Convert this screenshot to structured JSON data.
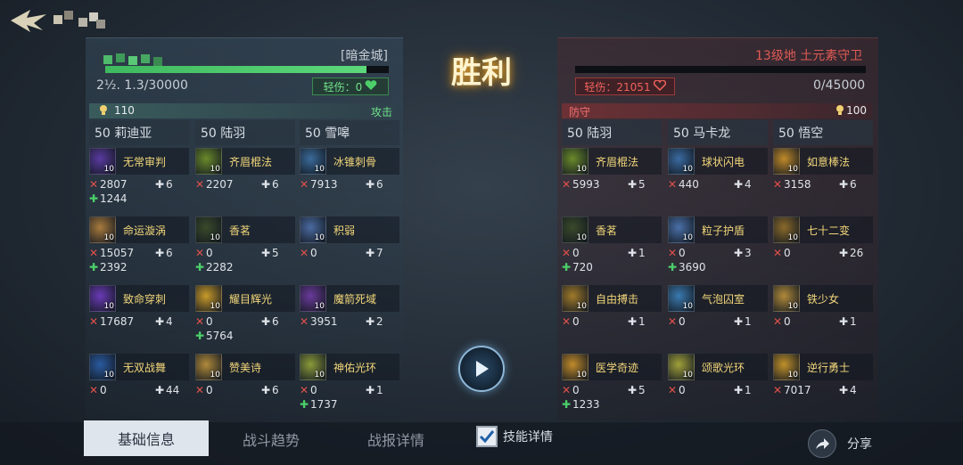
{
  "title": "胜利",
  "left": {
    "player_name": "",
    "city": "[暗金城]",
    "troops": "2½. 1.3/30000",
    "injury_label": "轻伤：0",
    "troop_fill": 0.92,
    "side_count": "110",
    "side_label": "攻击",
    "heroes": [
      {
        "header": "50 莉迪亚",
        "skills": [
          {
            "name": "无常审判",
            "level": "10",
            "kills": "2807",
            "plus": "6",
            "heal": "1244",
            "color": "#5a3aa0"
          },
          {
            "name": "命运漩涡",
            "level": "10",
            "kills": "15057",
            "plus": "6",
            "heal": "2392",
            "color": "#a87a3c"
          },
          {
            "name": "致命穿刺",
            "level": "10",
            "kills": "17687",
            "plus": "4",
            "heal": "",
            "color": "#6a3ab6"
          },
          {
            "name": "无双战舞",
            "level": "10",
            "kills": "0",
            "plus": "44",
            "heal": "",
            "color": "#2a5aa0"
          }
        ]
      },
      {
        "header": "50 陆羽",
        "skills": [
          {
            "name": "齐眉棍法",
            "level": "10",
            "kills": "2207",
            "plus": "6",
            "heal": "",
            "color": "#6a8a2a"
          },
          {
            "name": "香茗",
            "level": "10",
            "kills": "0",
            "plus": "5",
            "heal": "2282",
            "color": "#3a4a2a"
          },
          {
            "name": "耀目辉光",
            "level": "10",
            "kills": "0",
            "plus": "6",
            "heal": "5764",
            "color": "#c89a2a"
          },
          {
            "name": "赞美诗",
            "level": "10",
            "kills": "0",
            "plus": "6",
            "heal": "",
            "color": "#b08a3a"
          }
        ]
      },
      {
        "header": "50 雪嗥",
        "skills": [
          {
            "name": "冰锥刺骨",
            "level": "10",
            "kills": "7913",
            "plus": "6",
            "heal": "",
            "color": "#3a6a9a"
          },
          {
            "name": "积弱",
            "level": "10",
            "kills": "0",
            "plus": "7",
            "heal": "",
            "color": "#4a6aa0"
          },
          {
            "name": "魔箭死域",
            "level": "10",
            "kills": "3951",
            "plus": "2",
            "heal": "",
            "color": "#6a3a9a"
          },
          {
            "name": "神佑光环",
            "level": "10",
            "kills": "0",
            "plus": "1",
            "heal": "1737",
            "color": "#8a9a3a"
          }
        ]
      }
    ]
  },
  "right": {
    "enemy_title": "13级地 土元素守卫",
    "troops": "0/45000",
    "injury_label": "轻伤：21051",
    "troop_fill": 0.0,
    "side_count": "100",
    "side_label": "防守",
    "heroes": [
      {
        "header": "50 陆羽",
        "skills": [
          {
            "name": "齐眉棍法",
            "level": "10",
            "kills": "5993",
            "plus": "5",
            "heal": "",
            "color": "#6a8a2a"
          },
          {
            "name": "香茗",
            "level": "10",
            "kills": "0",
            "plus": "1",
            "heal": "720",
            "color": "#3a4a2a"
          },
          {
            "name": "自由搏击",
            "level": "10",
            "kills": "0",
            "plus": "1",
            "heal": "",
            "color": "#a07a2a"
          },
          {
            "name": "医学奇迹",
            "level": "10",
            "kills": "0",
            "plus": "5",
            "heal": "1233",
            "color": "#c08a2a"
          }
        ]
      },
      {
        "header": "50 马卡龙",
        "skills": [
          {
            "name": "球状闪电",
            "level": "10",
            "kills": "440",
            "plus": "4",
            "heal": "",
            "color": "#3a6aa0"
          },
          {
            "name": "粒子护盾",
            "level": "10",
            "kills": "0",
            "plus": "3",
            "heal": "3690",
            "color": "#4a70a8"
          },
          {
            "name": "气泡囚室",
            "level": "10",
            "kills": "0",
            "plus": "1",
            "heal": "",
            "color": "#3a7ab0"
          },
          {
            "name": "颂歌光环",
            "level": "10",
            "kills": "0",
            "plus": "1",
            "heal": "",
            "color": "#a0a03a"
          }
        ]
      },
      {
        "header": "50 悟空",
        "skills": [
          {
            "name": "如意棒法",
            "level": "10",
            "kills": "3158",
            "plus": "6",
            "heal": "",
            "color": "#c08a2a"
          },
          {
            "name": "七十二变",
            "level": "10",
            "kills": "0",
            "plus": "26",
            "heal": "",
            "color": "#8a6a2a"
          },
          {
            "name": "铁少女",
            "level": "10",
            "kills": "0",
            "plus": "1",
            "heal": "",
            "color": "#b08a3a"
          },
          {
            "name": "逆行勇士",
            "level": "10",
            "kills": "7017",
            "plus": "4",
            "heal": "",
            "color": "#c0902a"
          }
        ]
      }
    ]
  },
  "tabs": [
    "基础信息",
    "战斗趋势",
    "战报详情"
  ],
  "checkbox_label": "技能详情",
  "share_label": "分享",
  "colors": {
    "victory_glow": "#e0a030",
    "ally_green": "#4ccf6a",
    "enemy_red": "#e05a55",
    "skill_name": "#f3d77a"
  },
  "icons": {
    "back": "back-arrow-icon",
    "play": "play-icon",
    "check": "check-icon",
    "share": "share-arrow-icon",
    "heart": "heart-icon",
    "lightbulb": "lightbulb-icon"
  }
}
